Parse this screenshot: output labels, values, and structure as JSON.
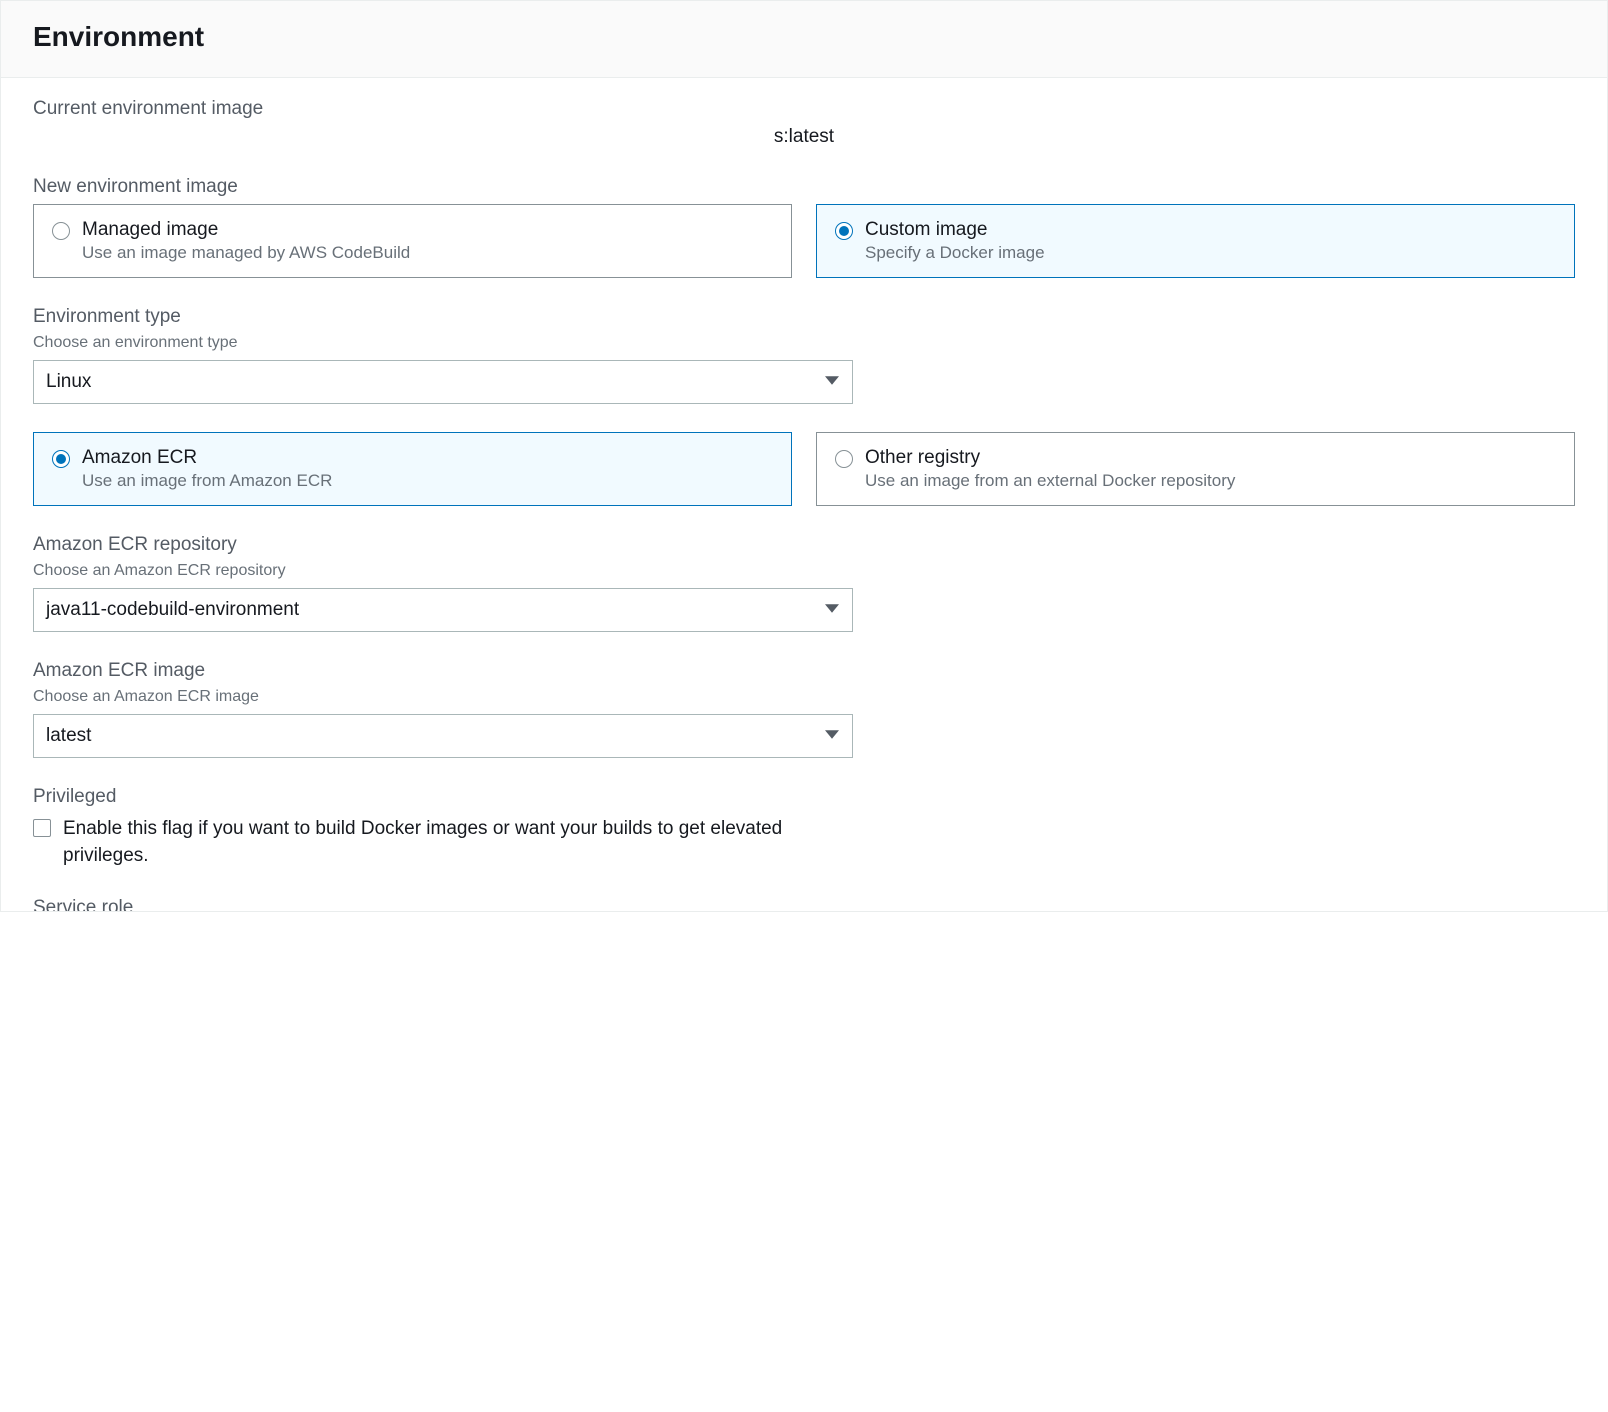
{
  "header": {
    "title": "Environment"
  },
  "current": {
    "label": "Current environment image",
    "value": "s:latest"
  },
  "newImage": {
    "label": "New environment image",
    "managed": {
      "title": "Managed image",
      "desc": "Use an image managed by AWS CodeBuild"
    },
    "custom": {
      "title": "Custom image",
      "desc": "Specify a Docker image"
    }
  },
  "envType": {
    "label": "Environment type",
    "hint": "Choose an environment type",
    "value": "Linux"
  },
  "registry": {
    "ecr": {
      "title": "Amazon ECR",
      "desc": "Use an image from Amazon ECR"
    },
    "other": {
      "title": "Other registry",
      "desc": "Use an image from an external Docker repository"
    }
  },
  "ecrRepo": {
    "label": "Amazon ECR repository",
    "hint": "Choose an Amazon ECR repository",
    "value": "java11-codebuild-environment"
  },
  "ecrImage": {
    "label": "Amazon ECR image",
    "hint": "Choose an Amazon ECR image",
    "value": "latest"
  },
  "privileged": {
    "label": "Privileged",
    "checkboxLabel": "Enable this flag if you want to build Docker images or want your builds to get elevated privileges."
  },
  "serviceRole": {
    "label": "Service role"
  }
}
